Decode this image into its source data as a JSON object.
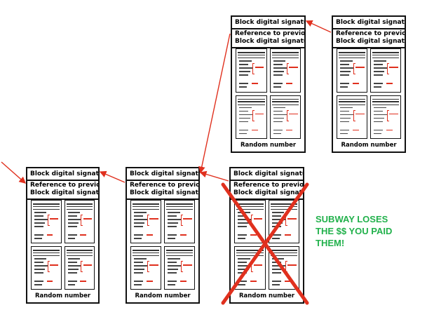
{
  "block_labels": {
    "signature": "Block digital signature",
    "reference_line1": "Reference to previous",
    "reference_line2": "Block digital signature",
    "random": "Random number"
  },
  "caption": {
    "line1": "SUBWAY LOSES",
    "line2": "THE $$ YOU PAID",
    "line3": "THEM!"
  },
  "colors": {
    "arrow": "#e0301e",
    "cross": "#e0301e",
    "caption": "#22b14c"
  }
}
